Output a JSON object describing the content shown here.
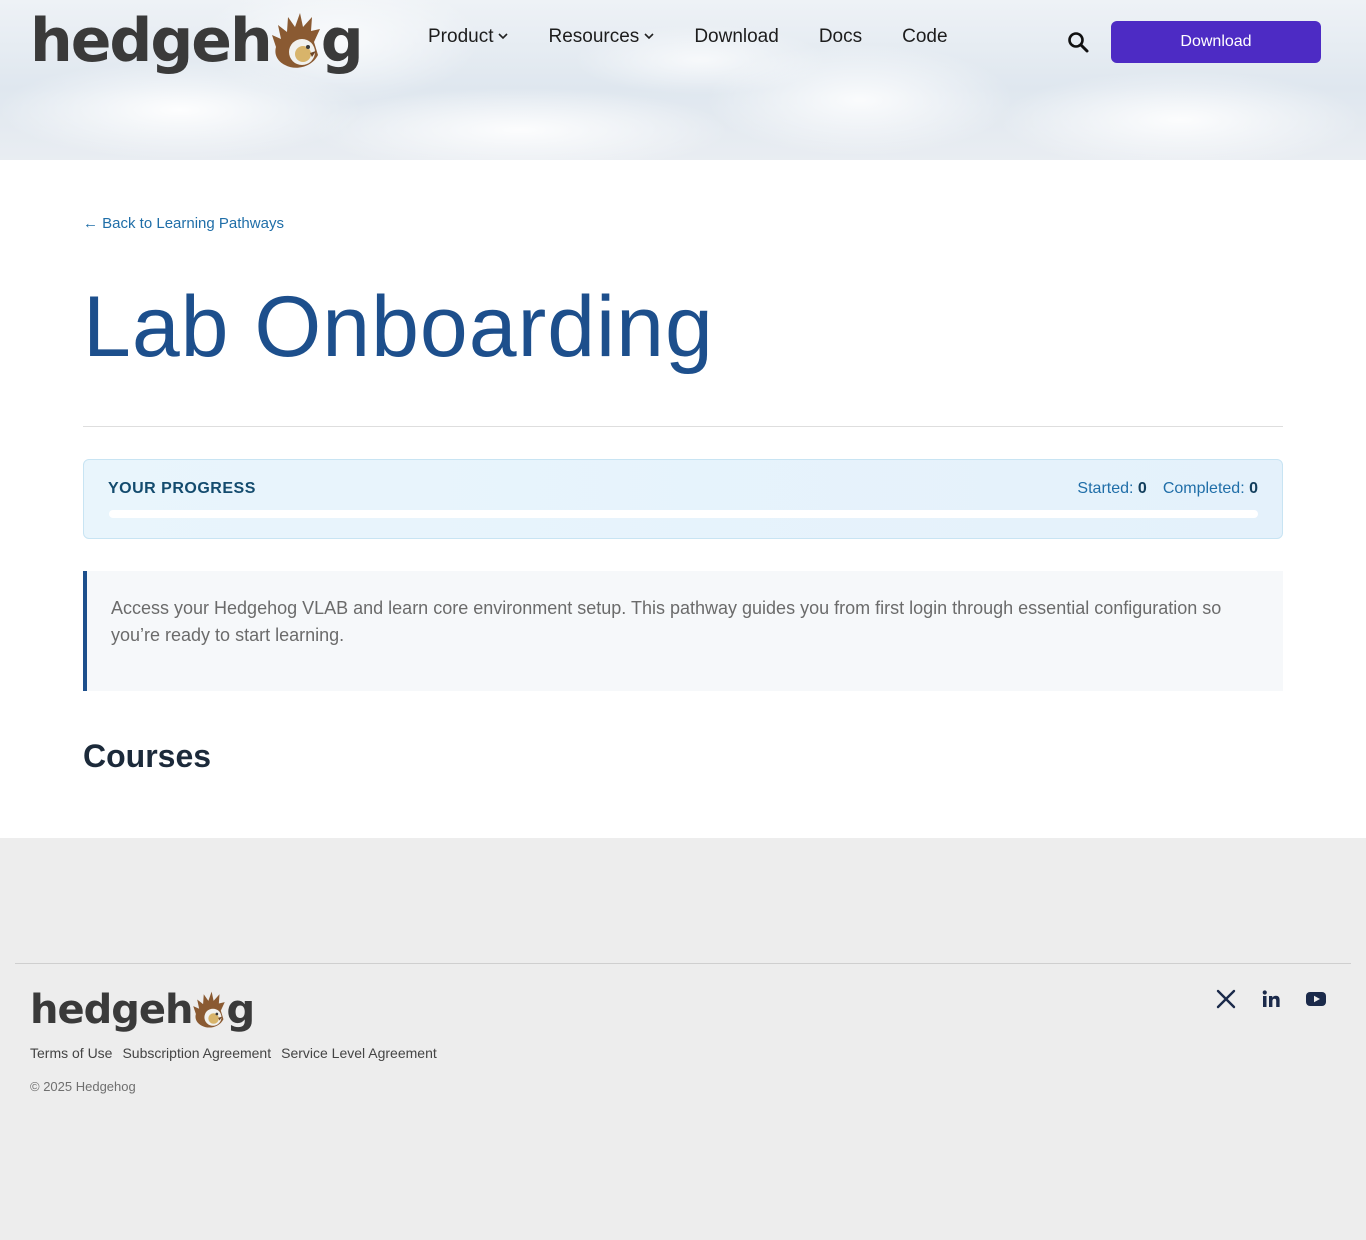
{
  "header": {
    "logo_text_left": "hedgeh",
    "logo_text_right": "g",
    "nav": [
      {
        "label": "Product",
        "has_dropdown": true
      },
      {
        "label": "Resources",
        "has_dropdown": true
      },
      {
        "label": "Download",
        "has_dropdown": false
      },
      {
        "label": "Docs",
        "has_dropdown": false
      },
      {
        "label": "Code",
        "has_dropdown": false
      }
    ],
    "search_icon": "search-icon",
    "cta_label": "Download"
  },
  "main": {
    "back_link": "← Back to Learning Pathways",
    "title": "Lab Onboarding",
    "progress": {
      "label": "YOUR PROGRESS",
      "started_label": "Started:",
      "started_value": "0",
      "completed_label": "Completed:",
      "completed_value": "0",
      "percent": 0
    },
    "description": "Access your Hedgehog VLAB and learn core environment setup. This pathway guides you from first login through essential configuration so you’re ready to start learning.",
    "courses_heading": "Courses"
  },
  "footer": {
    "logo_text_left": "hedgeh",
    "logo_text_right": "g",
    "links": [
      "Terms of Use",
      "Subscription Agreement",
      "Service Level Agreement"
    ],
    "copyright": "© 2025 Hedgehog",
    "social": [
      "x-icon",
      "linkedin-icon",
      "youtube-icon"
    ]
  },
  "colors": {
    "accent": "#4d2bc4",
    "title": "#1d4f8c",
    "link": "#1f6ea8",
    "hog_brown": "#8a5a32"
  }
}
